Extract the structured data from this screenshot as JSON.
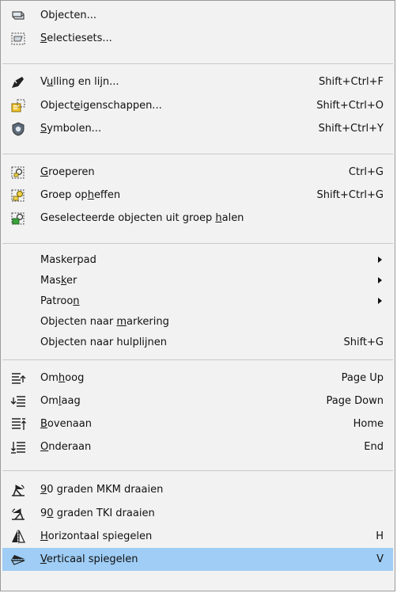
{
  "colors": {
    "menu_bg": "#f2f2f2",
    "selected_bg": "#9fcdf5",
    "separator": "#c8c8c8",
    "text": "#111111"
  },
  "items": [
    {
      "icon": "objects-panel-icon",
      "pre": "Ob",
      "u": "j",
      "post": "ecten...",
      "shortcut": ""
    },
    {
      "icon": "selection-sets-icon",
      "pre": "",
      "u": "S",
      "post": "electiesets...",
      "shortcut": ""
    },
    {
      "icon": "fill-stroke-icon",
      "pre": "V",
      "u": "u",
      "post": "lling en lijn...",
      "shortcut": "Shift+Ctrl+F"
    },
    {
      "icon": "object-properties-icon",
      "pre": "Object",
      "u": "e",
      "post": "igenschappen...",
      "shortcut": "Shift+Ctrl+O"
    },
    {
      "icon": "symbols-icon",
      "pre": "",
      "u": "S",
      "post": "ymbolen...",
      "shortcut": "Shift+Ctrl+Y"
    },
    {
      "icon": "group-icon",
      "pre": "",
      "u": "G",
      "post": "roeperen",
      "shortcut": "Ctrl+G"
    },
    {
      "icon": "ungroup-icon",
      "pre": "Groep op",
      "u": "h",
      "post": "effen",
      "shortcut": "Shift+Ctrl+G"
    },
    {
      "icon": "pop-from-group-icon",
      "pre": "Geselecteerde objecten uit groep ",
      "u": "h",
      "post": "alen",
      "shortcut": ""
    },
    {
      "icon": "",
      "pre": "Maskerpad",
      "u": "",
      "post": "",
      "shortcut": "",
      "submenu": true
    },
    {
      "icon": "",
      "pre": "Mas",
      "u": "k",
      "post": "er",
      "shortcut": "",
      "submenu": true
    },
    {
      "icon": "",
      "pre": "Patroo",
      "u": "n",
      "post": "",
      "shortcut": "",
      "submenu": true
    },
    {
      "icon": "",
      "pre": "Objecten naar ",
      "u": "m",
      "post": "arkering",
      "shortcut": ""
    },
    {
      "icon": "",
      "pre": "Objecten naar hulplijnen",
      "u": "",
      "post": "",
      "shortcut": "Shift+G"
    },
    {
      "icon": "raise-icon",
      "pre": "Om",
      "u": "h",
      "post": "oog",
      "shortcut": "Page Up"
    },
    {
      "icon": "lower-icon",
      "pre": "Om",
      "u": "l",
      "post": "aag",
      "shortcut": "Page Down"
    },
    {
      "icon": "raise-to-top-icon",
      "pre": "",
      "u": "B",
      "post": "ovenaan",
      "shortcut": "Home"
    },
    {
      "icon": "lower-to-bottom-icon",
      "pre": "",
      "u": "O",
      "post": "nderaan",
      "shortcut": "End"
    },
    {
      "icon": "rotate-ccw-icon",
      "pre": "",
      "u": "9",
      "post": "0 graden MKM draaien",
      "shortcut": ""
    },
    {
      "icon": "rotate-cw-icon",
      "pre": "9",
      "u": "0",
      "post": " graden TKI draaien",
      "shortcut": ""
    },
    {
      "icon": "flip-horizontal-icon",
      "pre": "",
      "u": "H",
      "post": "orizontaal spiegelen",
      "shortcut": "H"
    },
    {
      "icon": "flip-vertical-icon",
      "pre": "",
      "u": "V",
      "post": "erticaal spiegelen",
      "shortcut": "V",
      "selected": true
    }
  ]
}
